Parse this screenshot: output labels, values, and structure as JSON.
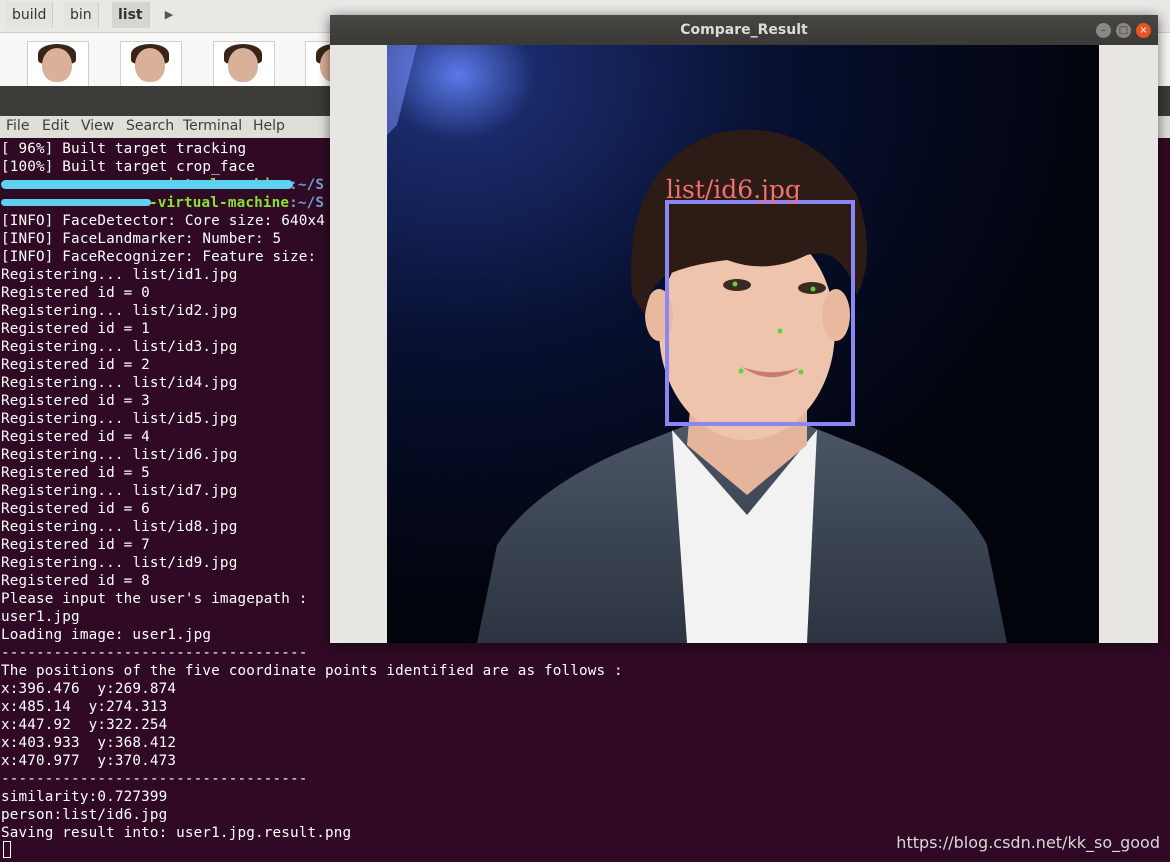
{
  "file_manager": {
    "breadcrumbs": [
      "build",
      "bin",
      "list"
    ],
    "active_crumb": "list"
  },
  "terminal": {
    "menu": [
      "File",
      "Edit",
      "View",
      "Search",
      "Terminal",
      "Help"
    ],
    "lines": [
      "[ 96%] Built target tracking",
      "[100%] Built target crop_face",
      "",
      "",
      "[INFO] FaceDetector: Core size: 640x4",
      "[INFO] FaceLandmarker: Number: 5",
      "[INFO] FaceRecognizer: Feature size:",
      "Registering... list/id1.jpg",
      "Registered id = 0",
      "Registering... list/id2.jpg",
      "Registered id = 1",
      "Registering... list/id3.jpg",
      "Registered id = 2",
      "Registering... list/id4.jpg",
      "Registered id = 3",
      "Registering... list/id5.jpg",
      "Registered id = 4",
      "Registering... list/id6.jpg",
      "Registered id = 5",
      "Registering... list/id7.jpg",
      "Registered id = 6",
      "Registering... list/id8.jpg",
      "Registered id = 7",
      "Registering... list/id9.jpg",
      "Registered id = 8",
      "Please input the user's imagepath :",
      "user1.jpg",
      "Loading image: user1.jpg",
      "-----------------------------------",
      "The positions of the five coordinate points identified are as follows :",
      "x:396.476  y:269.874",
      "x:485.14  y:274.313",
      "x:447.92  y:322.254",
      "x:403.933  y:368.412",
      "x:470.977  y:370.473",
      "-----------------------------------",
      "similarity:0.727399",
      "person:list/id6.jpg",
      "Saving result into: user1.jpg.result.png"
    ],
    "prompt1_host": "-virtual-machine",
    "prompt1_path": ":~/S",
    "prompt2_host": "-virtual-machine",
    "prompt2_path": ":~/S"
  },
  "result_window": {
    "title": "Compare_Result",
    "match_label": "list/id6.jpg",
    "box_color": "#8a86f2",
    "label_color": "#f07070",
    "landmark_color": "#60d040"
  },
  "watermark": "https://blog.csdn.net/kk_so_good"
}
